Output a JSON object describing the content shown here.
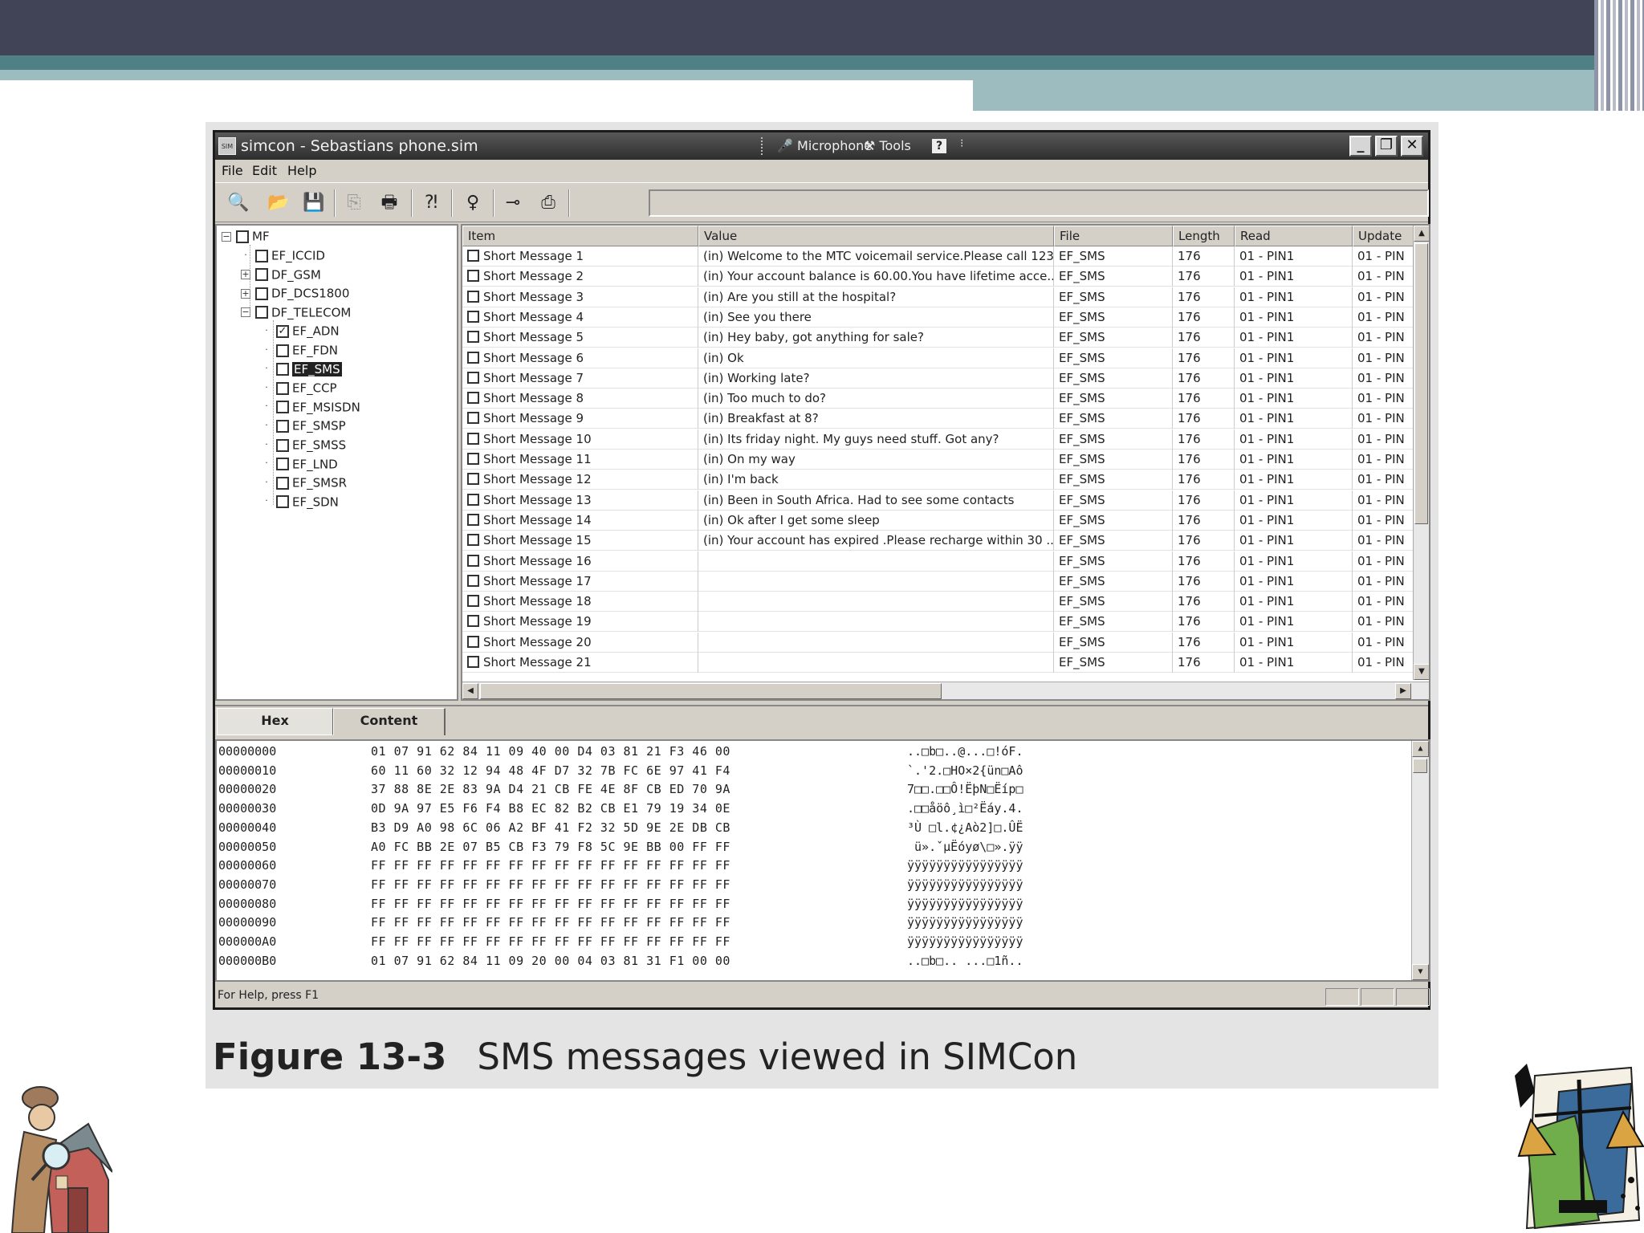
{
  "window": {
    "title": "simcon - Sebastians phone.sim",
    "app_icon_text": "SIM",
    "toolbar_menus": [
      "Microphone",
      "Tools"
    ],
    "help_glyph": "?",
    "controls": [
      "_",
      "❐",
      "✕"
    ]
  },
  "menu": [
    "File",
    "Edit",
    "Help"
  ],
  "tree": {
    "root": "MF",
    "items": [
      {
        "label": "EF_ICCID",
        "level": 1,
        "checked": false,
        "expander": ""
      },
      {
        "label": "DF_GSM",
        "level": 1,
        "checked": false,
        "expander": "+"
      },
      {
        "label": "DF_DCS1800",
        "level": 1,
        "checked": false,
        "expander": "+"
      },
      {
        "label": "DF_TELECOM",
        "level": 1,
        "checked": false,
        "expander": "-"
      },
      {
        "label": "EF_ADN",
        "level": 2,
        "checked": true,
        "expander": ""
      },
      {
        "label": "EF_FDN",
        "level": 2,
        "checked": false,
        "expander": ""
      },
      {
        "label": "EF_SMS",
        "level": 2,
        "checked": false,
        "expander": "",
        "selected": true
      },
      {
        "label": "EF_CCP",
        "level": 2,
        "checked": false,
        "expander": ""
      },
      {
        "label": "EF_MSISDN",
        "level": 2,
        "checked": false,
        "expander": ""
      },
      {
        "label": "EF_SMSP",
        "level": 2,
        "checked": false,
        "expander": ""
      },
      {
        "label": "EF_SMSS",
        "level": 2,
        "checked": false,
        "expander": ""
      },
      {
        "label": "EF_LND",
        "level": 2,
        "checked": false,
        "expander": ""
      },
      {
        "label": "EF_SMSR",
        "level": 2,
        "checked": false,
        "expander": ""
      },
      {
        "label": "EF_SDN",
        "level": 2,
        "checked": false,
        "expander": ""
      }
    ]
  },
  "list": {
    "columns": [
      "Item",
      "Value",
      "File",
      "Length",
      "Read",
      "Update"
    ],
    "rows": [
      {
        "item": "Short Message 1",
        "value": "(in) Welcome to the MTC voicemail service.Please call 123...",
        "file": "EF_SMS",
        "length": "176",
        "read": "01 - PIN1",
        "update": "01 - PIN"
      },
      {
        "item": "Short Message 2",
        "value": "(in) Your account balance is 60.00.You have lifetime acce...",
        "file": "EF_SMS",
        "length": "176",
        "read": "01 - PIN1",
        "update": "01 - PIN"
      },
      {
        "item": "Short Message 3",
        "value": "(in) Are you still at the hospital?",
        "file": "EF_SMS",
        "length": "176",
        "read": "01 - PIN1",
        "update": "01 - PIN"
      },
      {
        "item": "Short Message 4",
        "value": "(in) See you there",
        "file": "EF_SMS",
        "length": "176",
        "read": "01 - PIN1",
        "update": "01 - PIN"
      },
      {
        "item": "Short Message 5",
        "value": "(in) Hey baby, got anything for sale?",
        "file": "EF_SMS",
        "length": "176",
        "read": "01 - PIN1",
        "update": "01 - PIN"
      },
      {
        "item": "Short Message 6",
        "value": "(in) Ok",
        "file": "EF_SMS",
        "length": "176",
        "read": "01 - PIN1",
        "update": "01 - PIN"
      },
      {
        "item": "Short Message 7",
        "value": "(in) Working late?",
        "file": "EF_SMS",
        "length": "176",
        "read": "01 - PIN1",
        "update": "01 - PIN"
      },
      {
        "item": "Short Message 8",
        "value": "(in) Too much to do?",
        "file": "EF_SMS",
        "length": "176",
        "read": "01 - PIN1",
        "update": "01 - PIN"
      },
      {
        "item": "Short Message 9",
        "value": "(in) Breakfast at 8?",
        "file": "EF_SMS",
        "length": "176",
        "read": "01 - PIN1",
        "update": "01 - PIN"
      },
      {
        "item": "Short Message 10",
        "value": "(in) Its friday night. My guys need stuff. Got any?",
        "file": "EF_SMS",
        "length": "176",
        "read": "01 - PIN1",
        "update": "01 - PIN"
      },
      {
        "item": "Short Message 11",
        "value": "(in) On my way",
        "file": "EF_SMS",
        "length": "176",
        "read": "01 - PIN1",
        "update": "01 - PIN"
      },
      {
        "item": "Short Message 12",
        "value": "(in) I'm back",
        "file": "EF_SMS",
        "length": "176",
        "read": "01 - PIN1",
        "update": "01 - PIN"
      },
      {
        "item": "Short Message 13",
        "value": "(in) Been in South Africa. Had to see some contacts",
        "file": "EF_SMS",
        "length": "176",
        "read": "01 - PIN1",
        "update": "01 - PIN"
      },
      {
        "item": "Short Message 14",
        "value": "(in) Ok after I get some sleep",
        "file": "EF_SMS",
        "length": "176",
        "read": "01 - PIN1",
        "update": "01 - PIN"
      },
      {
        "item": "Short Message 15",
        "value": "(in) Your account has expired .Please recharge within 30 ...",
        "file": "EF_SMS",
        "length": "176",
        "read": "01 - PIN1",
        "update": "01 - PIN"
      },
      {
        "item": "Short Message 16",
        "value": "",
        "file": "EF_SMS",
        "length": "176",
        "read": "01 - PIN1",
        "update": "01 - PIN"
      },
      {
        "item": "Short Message 17",
        "value": "",
        "file": "EF_SMS",
        "length": "176",
        "read": "01 - PIN1",
        "update": "01 - PIN"
      },
      {
        "item": "Short Message 18",
        "value": "",
        "file": "EF_SMS",
        "length": "176",
        "read": "01 - PIN1",
        "update": "01 - PIN"
      },
      {
        "item": "Short Message 19",
        "value": "",
        "file": "EF_SMS",
        "length": "176",
        "read": "01 - PIN1",
        "update": "01 - PIN"
      },
      {
        "item": "Short Message 20",
        "value": "",
        "file": "EF_SMS",
        "length": "176",
        "read": "01 - PIN1",
        "update": "01 - PIN"
      },
      {
        "item": "Short Message 21",
        "value": "",
        "file": "EF_SMS",
        "length": "176",
        "read": "01 - PIN1",
        "update": "01 - PIN"
      }
    ]
  },
  "tabs": [
    {
      "label": "Hex",
      "active": true
    },
    {
      "label": "Content",
      "active": false
    }
  ],
  "hex": [
    {
      "offset": "00000000",
      "bytes": "01 07 91 62 84 11 09 40 00 D4 03 81 21 F3 46 00",
      "ascii": "..□b□..@...□!óF."
    },
    {
      "offset": "00000010",
      "bytes": "60 11 60 32 12 94 48 4F D7 32 7B FC 6E 97 41 F4",
      "ascii": "`.'2.□HO×2{ün□Aô"
    },
    {
      "offset": "00000020",
      "bytes": "37 88 8E 2E 83 9A D4 21 CB FE 4E 8F CB ED 70 9A",
      "ascii": "7□□.□□Ô!ËþN□Ëíp□"
    },
    {
      "offset": "00000030",
      "bytes": "0D 9A 97 E5 F6 F4 B8 EC 82 B2 CB E1 79 19 34 0E",
      "ascii": ".□□åöô¸ì□²Ëáy.4."
    },
    {
      "offset": "00000040",
      "bytes": "B3 D9 A0 98 6C 06 A2 BF 41 F2 32 5D 9E 2E DB CB",
      "ascii": "³Ù □l.¢¿Aò2]□.ÛË"
    },
    {
      "offset": "00000050",
      "bytes": "A0 FC BB 2E 07 B5 CB F3 79 F8 5C 9E BB 00 FF FF",
      "ascii": " ü».ˇµËóyø\\□».ÿÿ"
    },
    {
      "offset": "00000060",
      "bytes": "FF FF FF FF FF FF FF FF FF FF FF FF FF FF FF FF",
      "ascii": "ÿÿÿÿÿÿÿÿÿÿÿÿÿÿÿÿ"
    },
    {
      "offset": "00000070",
      "bytes": "FF FF FF FF FF FF FF FF FF FF FF FF FF FF FF FF",
      "ascii": "ÿÿÿÿÿÿÿÿÿÿÿÿÿÿÿÿ"
    },
    {
      "offset": "00000080",
      "bytes": "FF FF FF FF FF FF FF FF FF FF FF FF FF FF FF FF",
      "ascii": "ÿÿÿÿÿÿÿÿÿÿÿÿÿÿÿÿ"
    },
    {
      "offset": "00000090",
      "bytes": "FF FF FF FF FF FF FF FF FF FF FF FF FF FF FF FF",
      "ascii": "ÿÿÿÿÿÿÿÿÿÿÿÿÿÿÿÿ"
    },
    {
      "offset": "000000A0",
      "bytes": "FF FF FF FF FF FF FF FF FF FF FF FF FF FF FF FF",
      "ascii": "ÿÿÿÿÿÿÿÿÿÿÿÿÿÿÿÿ"
    },
    {
      "offset": "000000B0",
      "bytes": "01 07 91 62 84 11 09 20 00 04 03 81 31 F1 00 00",
      "ascii": "..□b□.. ...□1ñ.."
    }
  ],
  "status": {
    "text": "For Help, press F1"
  },
  "caption": {
    "number": "Figure 13-3",
    "text": "SMS messages viewed in SIMCon"
  },
  "icons": {
    "toolbar": [
      "find-icon",
      "open-folder-icon",
      "save-icon",
      "copy-icon",
      "print-icon",
      "context-help-icon",
      "pin-icon",
      "key-icon",
      "export-icon"
    ]
  }
}
